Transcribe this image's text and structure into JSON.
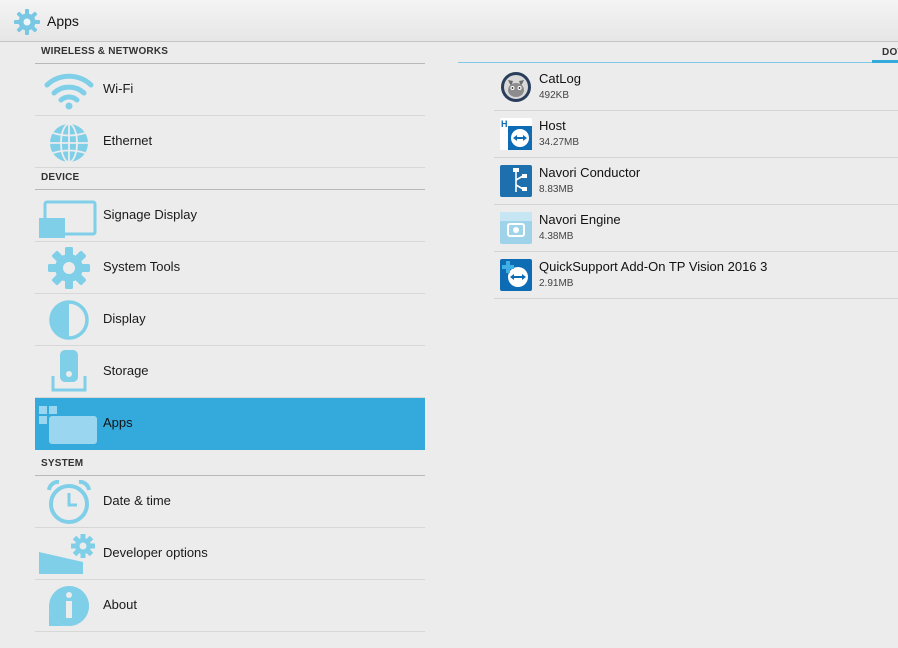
{
  "actionbar": {
    "title": "Apps"
  },
  "sidebar": {
    "sections": [
      {
        "header": "WIRELESS & NETWORKS"
      },
      {
        "header": "DEVICE"
      },
      {
        "header": "SYSTEM"
      }
    ],
    "items": [
      {
        "label": "Wi-Fi",
        "icon": "wifi-icon"
      },
      {
        "label": "Ethernet",
        "icon": "globe-icon"
      },
      {
        "label": "Signage Display",
        "icon": "cast-display-icon"
      },
      {
        "label": "System Tools",
        "icon": "gear-icon"
      },
      {
        "label": "Display",
        "icon": "brightness-icon"
      },
      {
        "label": "Storage",
        "icon": "storage-icon"
      },
      {
        "label": "Apps",
        "icon": "apps-icon",
        "selected": true
      },
      {
        "label": "Date & time",
        "icon": "alarm-clock-icon"
      },
      {
        "label": "Developer options",
        "icon": "developer-options-icon"
      },
      {
        "label": "About",
        "icon": "info-icon"
      }
    ]
  },
  "tabs": {
    "active_label": "DOW"
  },
  "apps": [
    {
      "name": "CatLog",
      "size": "492KB",
      "icon": "catlog-icon"
    },
    {
      "name": "Host",
      "size": "34.27MB",
      "icon": "teamviewer-host-icon"
    },
    {
      "name": "Navori Conductor",
      "size": "8.83MB",
      "icon": "navori-conductor-icon"
    },
    {
      "name": "Navori Engine",
      "size": "4.38MB",
      "icon": "navori-engine-icon"
    },
    {
      "name": "QuickSupport Add-On TP Vision 2016 3",
      "size": "2.91MB",
      "icon": "quicksupport-icon"
    }
  ],
  "colors": {
    "accent": "#33a9dc",
    "icon_tint": "#7fcfe8",
    "background": "#ececec"
  }
}
